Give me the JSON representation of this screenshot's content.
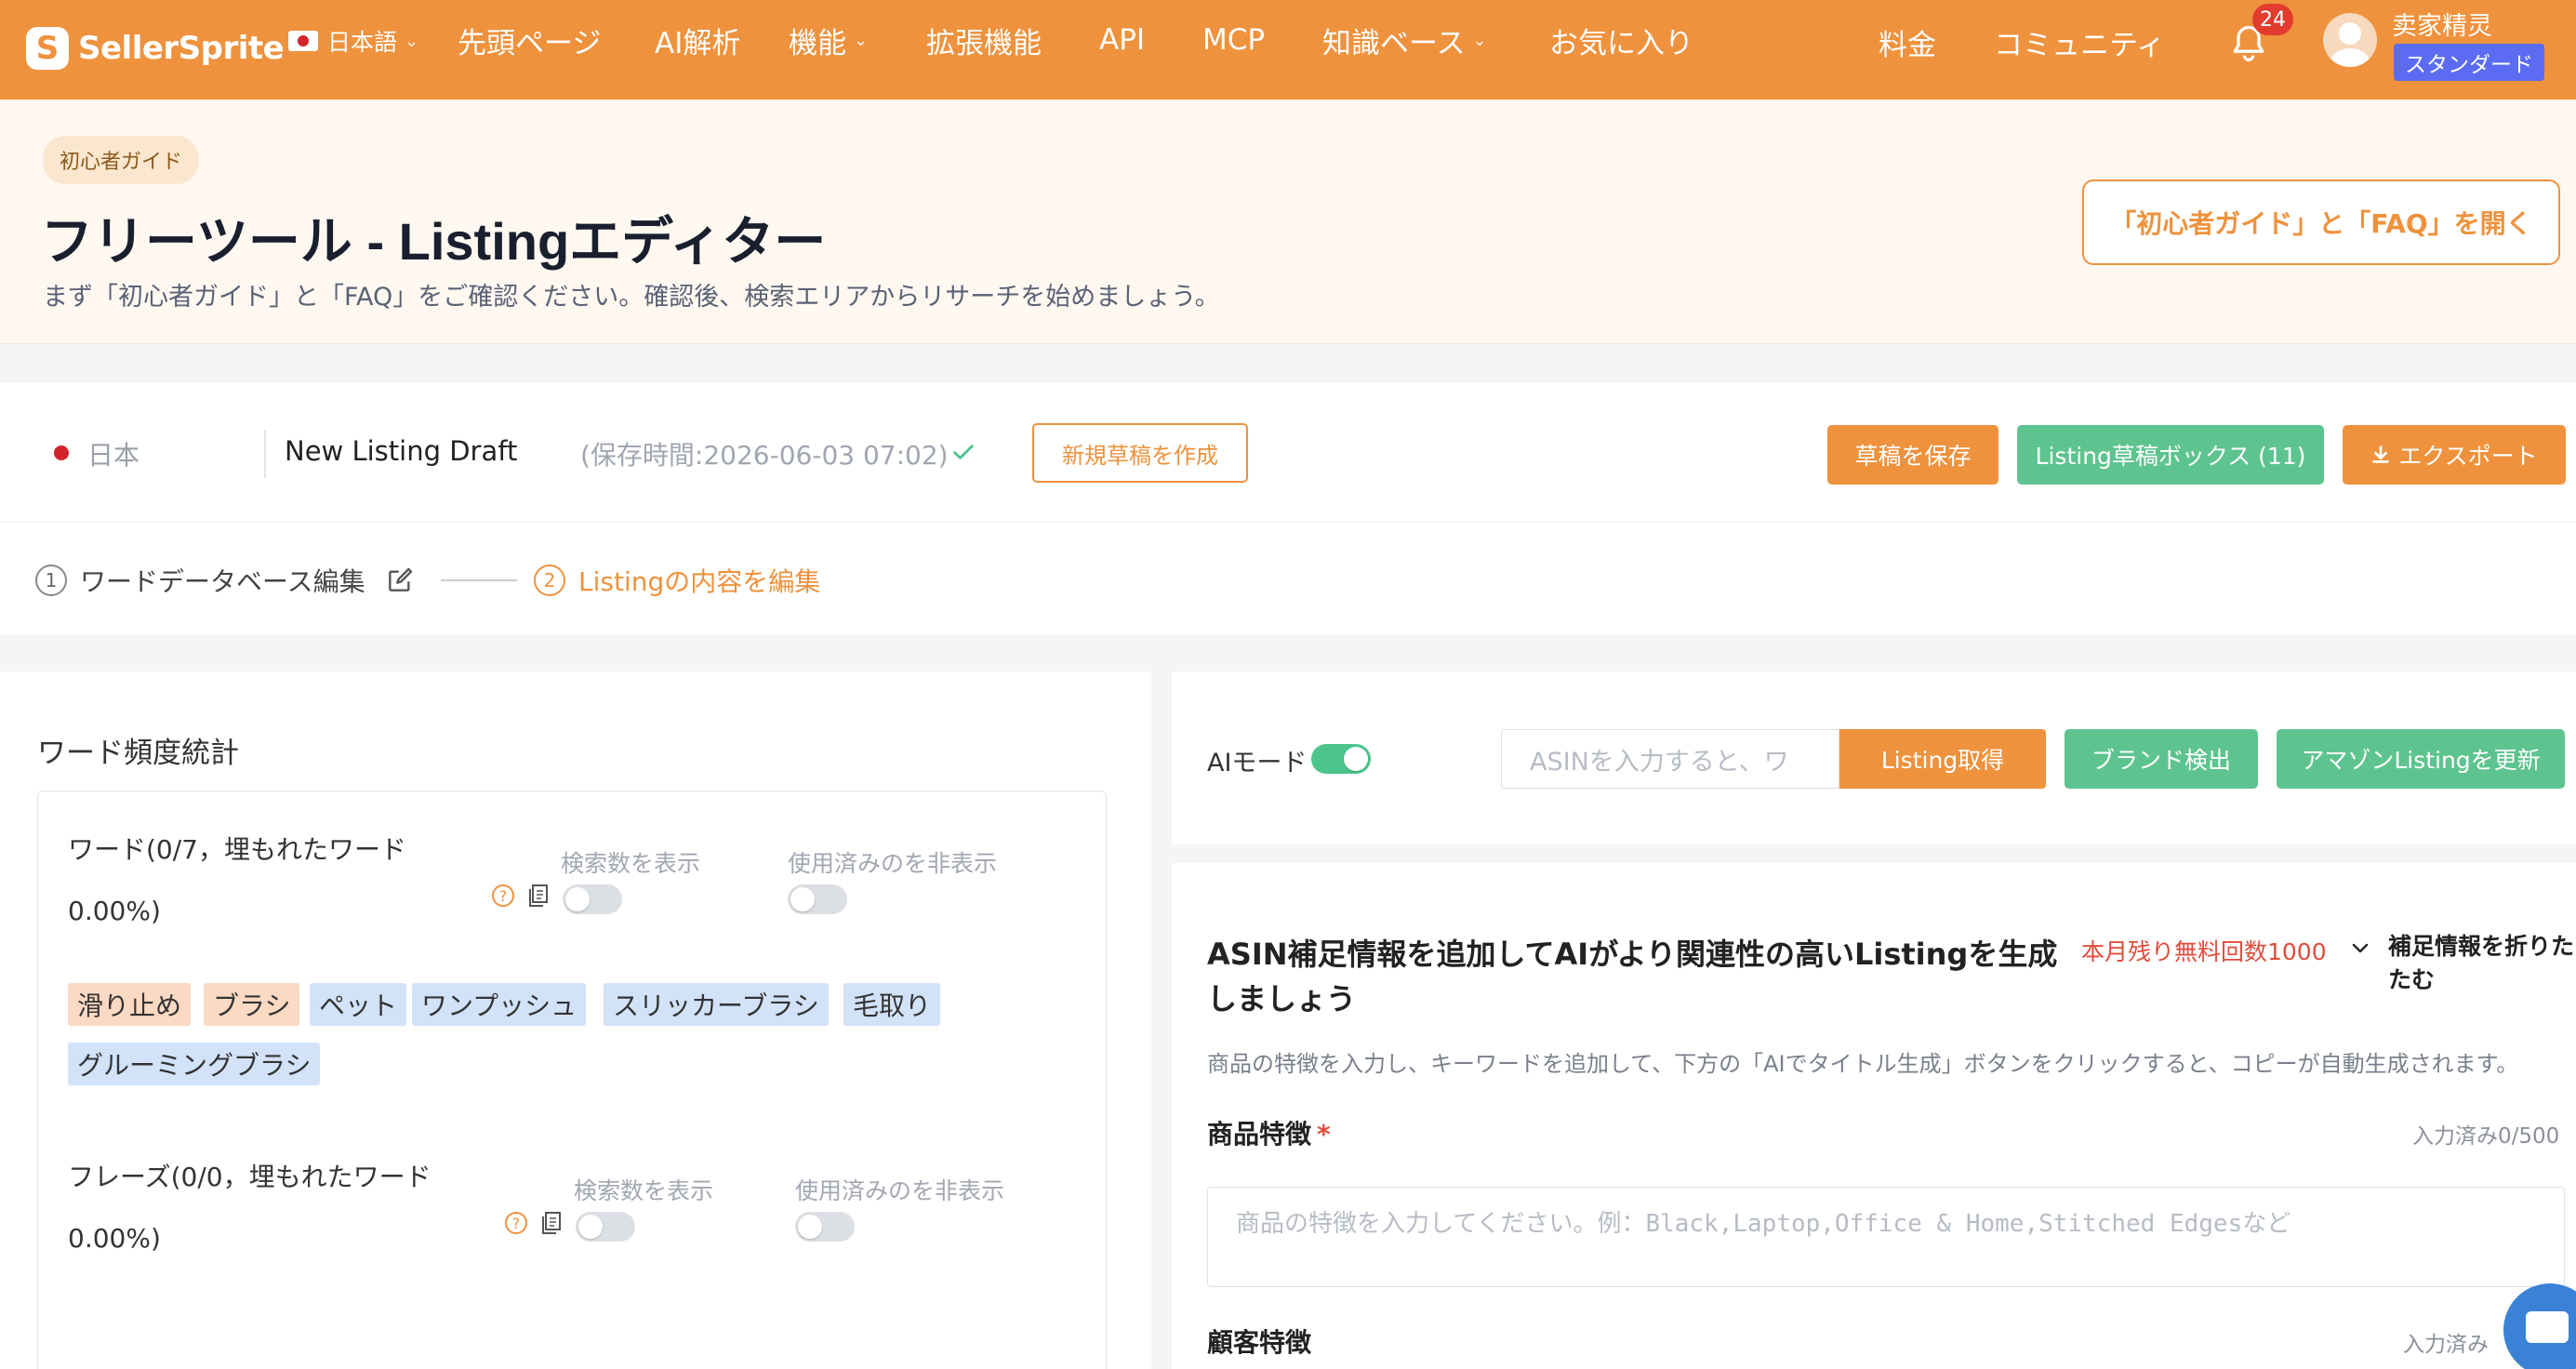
{
  "nav": {
    "logo_text": "SellerSprite",
    "language": "日本語",
    "items": [
      {
        "label": "先頭ページ"
      },
      {
        "label": "AI解析"
      },
      {
        "label": "機能"
      },
      {
        "label": "拡張機能"
      },
      {
        "label": "API"
      },
      {
        "label": "MCP"
      },
      {
        "label": "知識ベース"
      },
      {
        "label": "お気に入り"
      }
    ],
    "pricing": "料金",
    "community": "コミュニティ",
    "notification_count": "24",
    "username": "卖家精灵",
    "plan": "スタンダード"
  },
  "hero": {
    "chip": "初心者ガイド",
    "title": "フリーツール - Listingエディター",
    "subtitle": "まず「初心者ガイド」と「FAQ」をご確認ください。確認後、検索エリアからリサーチを始めましょう。",
    "faq_button": "「初心者ガイド」と「FAQ」を開く"
  },
  "draft": {
    "marketplace": "日本",
    "name": "New Listing Draft",
    "saved_time": "(保存時間:2026-06-03 07:02)",
    "new_draft_button": "新規草稿を作成",
    "save_button": "草稿を保存",
    "box_button": "Listing草稿ボックス (11)",
    "export_button": "エクスポート"
  },
  "steps": {
    "step1_num": "1",
    "step1_label": "ワードデータベース編集",
    "step2_num": "2",
    "step2_label": "Listingの内容を編集"
  },
  "left": {
    "title": "ワード頻度統計",
    "words_title": "ワード(0/7，埋もれたワード 0.00%)",
    "show_search": "検索数を表示",
    "hide_used": "使用済みのを非表示",
    "tags": [
      {
        "label": "滑り止め",
        "color": "orange"
      },
      {
        "label": "ブラシ",
        "color": "orange"
      },
      {
        "label": "ペット",
        "color": "blue"
      },
      {
        "label": "ワンプッシュ",
        "color": "blue"
      },
      {
        "label": "スリッカーブラシ",
        "color": "blue"
      },
      {
        "label": "毛取り",
        "color": "blue"
      },
      {
        "label": "グルーミングブラシ",
        "color": "blue"
      }
    ],
    "phrases_title": "フレーズ(0/0，埋もれたワード 0.00%)",
    "show_search_2": "検索数を表示",
    "hide_used_2": "使用済みのを非表示",
    "help_glyph": "?"
  },
  "right": {
    "ai_mode": "AIモード",
    "asin_placeholder": "ASINを入力すると、ワ",
    "get_listing": "Listing取得",
    "brand_check": "ブランド検出",
    "update_amazon": "アマゾンListingを更新",
    "section_title": "ASIN補足情報を追加してAIがより関連性の高いListingを生成しましょう",
    "free_count": "本月残り無料回数1000",
    "collapse": "補足情報を折りたたむ",
    "desc": "商品の特徴を入力し、キーワードを追加して、下方の「AIでタイトル生成」ボタンをクリックすると、コピーが自動生成されます。",
    "product_feature_label": "商品特徴",
    "required_mark": "*",
    "product_feature_counter": "入力済み0/500",
    "product_feature_placeholder": "商品の特徴を入力してください。例：Black,Laptop,Office & Home,Stitched Edgesなど",
    "customer_feature_label": "顧客特徴",
    "customer_feature_counter": "入力済み"
  },
  "colors": {
    "brand_orange": "#ee923d",
    "green": "#5ec48f",
    "plan_purple": "#5b6cf2"
  }
}
